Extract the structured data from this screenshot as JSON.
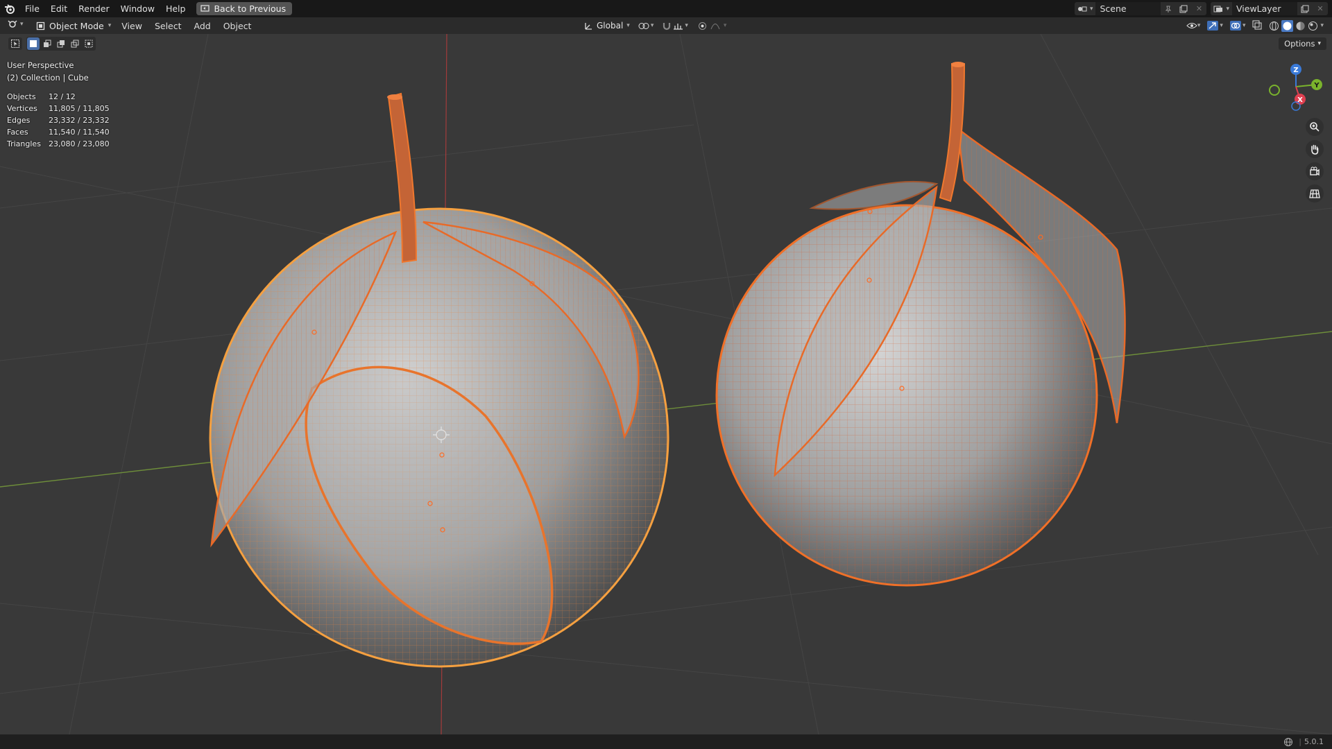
{
  "topbar": {
    "menus": [
      "File",
      "Edit",
      "Render",
      "Window",
      "Help"
    ],
    "back_label": "Back to Previous",
    "scene": "Scene",
    "viewlayer": "ViewLayer"
  },
  "header": {
    "mode": "Object Mode",
    "menus": [
      "View",
      "Select",
      "Add",
      "Object"
    ],
    "orientation": "Global"
  },
  "viewport": {
    "perspective": "User Perspective",
    "collection": "(2) Collection | Cube",
    "options_label": "Options",
    "stats": [
      {
        "label": "Objects",
        "value": "12 / 12"
      },
      {
        "label": "Vertices",
        "value": "11,805 / 11,805"
      },
      {
        "label": "Edges",
        "value": "23,332 / 23,332"
      },
      {
        "label": "Faces",
        "value": "11,540 / 11,540"
      },
      {
        "label": "Triangles",
        "value": "23,080 / 23,080"
      }
    ],
    "gizmo": {
      "x": "X",
      "y": "Y",
      "z": "Z"
    }
  },
  "status": {
    "version": "5.0.1"
  },
  "colors": {
    "selection": "#f06a18",
    "active": "#f5a040",
    "viewport": "#393939"
  }
}
